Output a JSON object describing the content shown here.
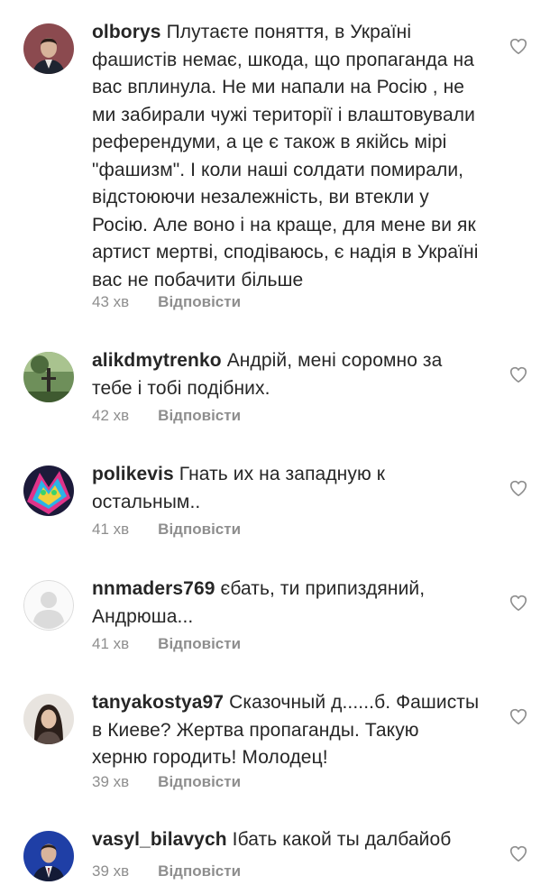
{
  "reply_label": "Відповісти",
  "comments": [
    {
      "username": "olborys",
      "text": "Плутаєте поняття, в Україні фашистів немає, шкода, що пропаганда на вас вплинула. Не ми напали на Росію , не ми забирали чужі території і влаштовували референдуми, а це є також в якійсь мірі \"фашизм\". І коли наші солдати помирали, відстоюючи незалежність, ви втекли у Росію. Але воно і на краще, для мене ви як артист мертві, сподіваюсь, є надія в Україні вас не побачити більше",
      "time": "43 хв"
    },
    {
      "username": "alikdmytrenko",
      "text": "Андрій, мені соромно за тебе і тобі подібних.",
      "time": "42 хв"
    },
    {
      "username": "polikevis",
      "text": "Гнать их  на западную к остальным..",
      "time": "41 хв"
    },
    {
      "username": "nnmaders769",
      "text": "єбать, ти припиздяний, Андрюша...",
      "time": "41 хв"
    },
    {
      "username": "tanyakostya97",
      "text": "Сказочный д......б. Фашисты в Киеве? Жертва пропаганды. Такую херню городить! Молодец!",
      "time": "39 хв"
    },
    {
      "username": "vasyl_bilavych",
      "text": "Ібать какой ты далбайоб",
      "time": "39 хв"
    }
  ]
}
